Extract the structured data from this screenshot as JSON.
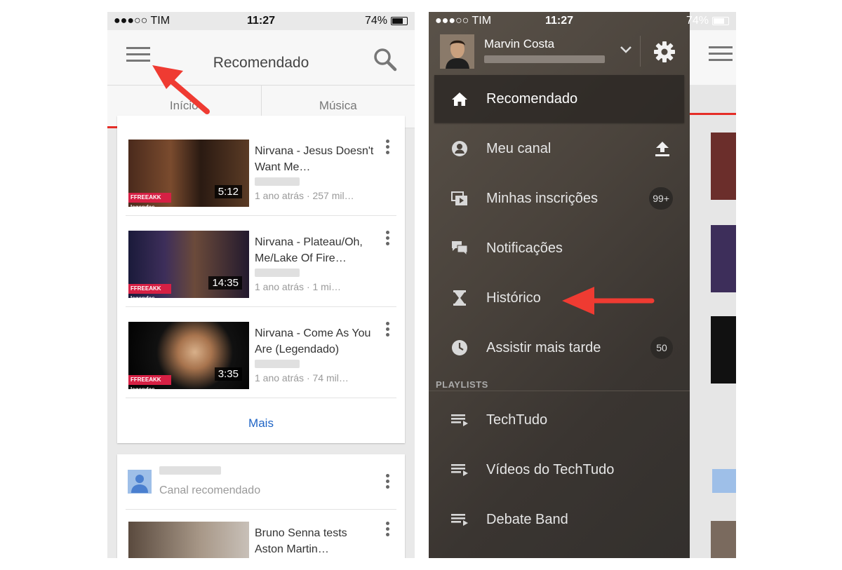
{
  "left": {
    "status": {
      "carrier": "●●●○○ TIM",
      "time": "11:27",
      "battery": "74%"
    },
    "appbar": {
      "title": "Recomendado"
    },
    "tabs": [
      {
        "label": "Início"
      },
      {
        "label": "Música"
      }
    ],
    "videos": [
      {
        "title": "Nirvana - Jesus Doesn't Want Me…",
        "meta": "1 ano atrás · 257 mil…",
        "duration": "5:12",
        "badge": "FFREEAKK legendas"
      },
      {
        "title": "Nirvana - Plateau/Oh, Me/Lake Of Fire…",
        "meta": "1 ano atrás · 1 mi…",
        "duration": "14:35",
        "badge": "FFREEAKK legendas"
      },
      {
        "title": "Nirvana - Come As You Are (Legendado)",
        "meta": "1 ano atrás · 74 mil…",
        "duration": "3:35",
        "badge": "FFREEAKK legendas"
      }
    ],
    "more_label": "Mais",
    "channel": {
      "label": "Canal recomendado"
    },
    "next_video": {
      "title": "Bruno Senna tests Aston Martin…"
    }
  },
  "right": {
    "status": {
      "carrier": "●●●○○ TIM",
      "time": "11:27",
      "battery": "74%"
    },
    "account": {
      "name": "Marvin Costa"
    },
    "menu": [
      {
        "label": "Recomendado",
        "icon": "home-icon"
      },
      {
        "label": "Meu canal",
        "icon": "account-circle-icon"
      },
      {
        "label": "Minhas inscrições",
        "icon": "subscriptions-icon",
        "count": "99+"
      },
      {
        "label": "Notificações",
        "icon": "chat-bubbles-icon"
      },
      {
        "label": "Histórico",
        "icon": "hourglass-icon"
      },
      {
        "label": "Assistir mais tarde",
        "icon": "clock-icon",
        "count": "50"
      }
    ],
    "playlists_header": "PLAYLISTS",
    "playlists": [
      {
        "label": "TechTudo"
      },
      {
        "label": "Vídeos do TechTudo"
      },
      {
        "label": "Debate Band"
      }
    ]
  },
  "colors": {
    "accent_red": "#e52d27",
    "link_blue": "#1f64c5",
    "annotation_arrow": "#ef3b32"
  }
}
